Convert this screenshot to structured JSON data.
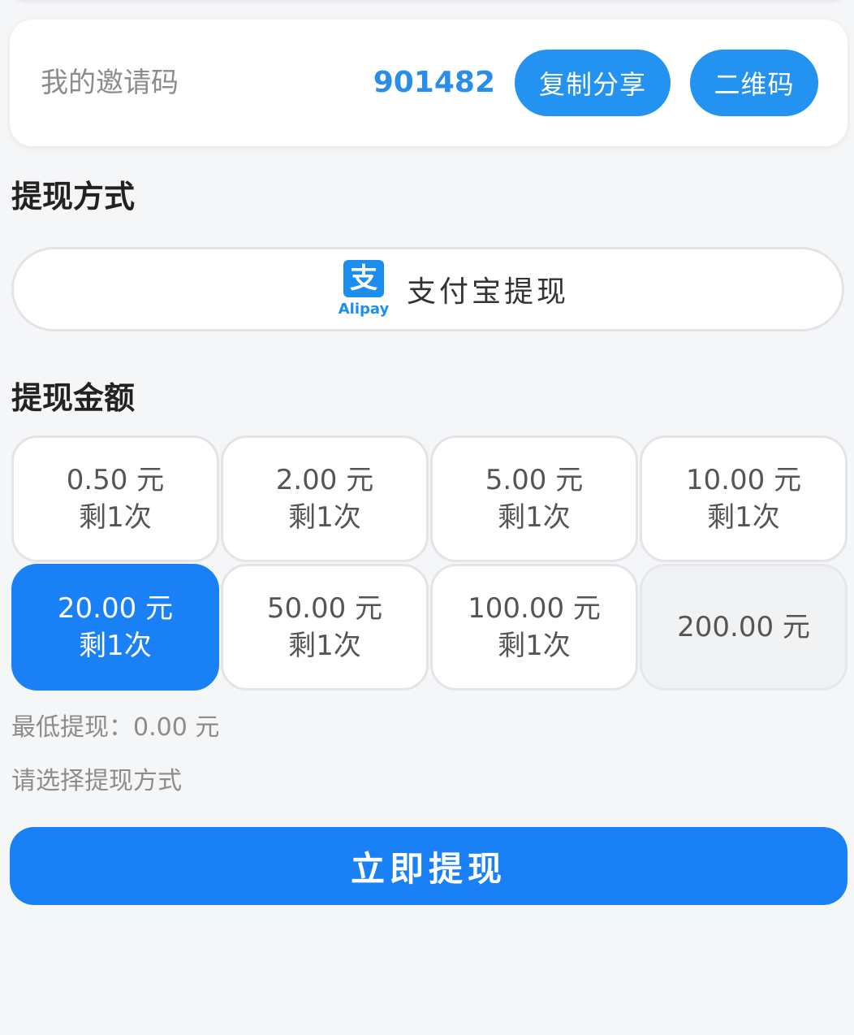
{
  "invite": {
    "label": "我的邀请码",
    "code": "901482",
    "copy_button": "复制分享",
    "qr_button": "二维码"
  },
  "withdraw_method": {
    "title": "提现方式",
    "alipay_logo_text": "支",
    "alipay_logo_caption": "Alipay",
    "alipay_label": "支付宝提现"
  },
  "withdraw_amount": {
    "title": "提现金额",
    "options": [
      {
        "amount": "0.50 元",
        "remaining": "剩1次"
      },
      {
        "amount": "2.00 元",
        "remaining": "剩1次"
      },
      {
        "amount": "5.00 元",
        "remaining": "剩1次"
      },
      {
        "amount": "10.00 元",
        "remaining": "剩1次"
      },
      {
        "amount": "20.00 元",
        "remaining": "剩1次"
      },
      {
        "amount": "50.00 元",
        "remaining": "剩1次"
      },
      {
        "amount": "100.00 元",
        "remaining": "剩1次"
      },
      {
        "amount": "200.00 元",
        "remaining": ""
      }
    ],
    "selected_index": 4
  },
  "min_withdraw": "最低提现：0.00 元",
  "hint": "请选择提现方式",
  "submit_button": "立即提现",
  "colors": {
    "accent": "#1980f5",
    "invite_code": "#2a8ee8",
    "pill_button": "#2392f0"
  }
}
